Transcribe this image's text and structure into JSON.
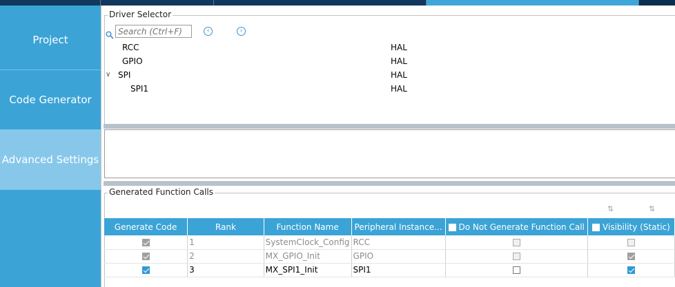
{
  "side_nav": {
    "items": [
      {
        "label": "Project"
      },
      {
        "label": "Code Generator"
      },
      {
        "label": "Advanced Settings"
      }
    ]
  },
  "driver_selector": {
    "title": "Driver Selector",
    "search_placeholder": "Search (Ctrl+F)",
    "rows": [
      {
        "name": "RCC",
        "driver": "HAL"
      },
      {
        "name": "GPIO",
        "driver": "HAL"
      },
      {
        "name": "SPI",
        "driver": "HAL"
      },
      {
        "name": "SPI1",
        "driver": "HAL"
      }
    ]
  },
  "function_calls": {
    "title": "Generated Function Calls",
    "columns": {
      "generate_code": "Generate Code",
      "rank": "Rank",
      "function_name": "Function Name",
      "peripheral_instance": "Peripheral Instance...",
      "do_not_generate": "Do Not Generate Function Call",
      "visibility": "Visibility (Static)"
    },
    "rows": [
      {
        "rank": "1",
        "function_name": "SystemClock_Config",
        "peripheral": "RCC"
      },
      {
        "rank": "2",
        "function_name": "MX_GPIO_Init",
        "peripheral": "GPIO"
      },
      {
        "rank": "3",
        "function_name": "MX_SPI1_Init",
        "peripheral": "SPI1"
      }
    ]
  },
  "colors": {
    "accent": "#3ba3d6",
    "nav_selected": "#87c8ea"
  }
}
